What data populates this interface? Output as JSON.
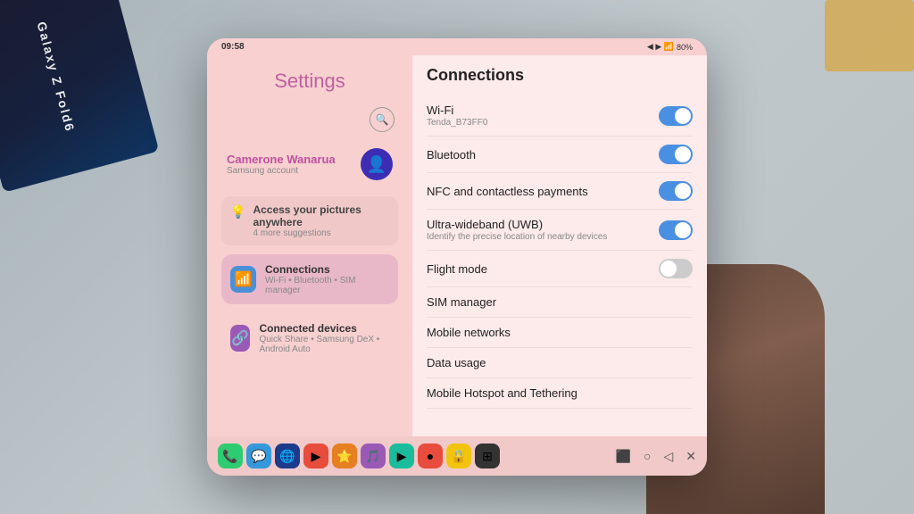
{
  "device": {
    "box_label": "Galaxy Z Fold6"
  },
  "status_bar": {
    "time": "09:58",
    "battery": "80%",
    "signal": "▲▼ 📶"
  },
  "left_panel": {
    "title": "Settings",
    "profile": {
      "name": "Camerone Wanarua",
      "subtitle": "Samsung account"
    },
    "suggestion": {
      "main": "Access your pictures anywhere",
      "sub": "4 more suggestions"
    },
    "menu_items": [
      {
        "id": "connections",
        "label": "Connections",
        "sub": "Wi-Fi • Bluetooth • SIM manager",
        "icon": "📶",
        "active": true
      },
      {
        "id": "connected-devices",
        "label": "Connected devices",
        "sub": "Quick Share • Samsung DeX • Android Auto",
        "icon": "🔗",
        "active": false
      }
    ]
  },
  "right_panel": {
    "title": "Connections",
    "settings": [
      {
        "id": "wifi",
        "label": "Wi-Fi",
        "sub": "Tenda_B73FF0",
        "toggle": "on"
      },
      {
        "id": "bluetooth",
        "label": "Bluetooth",
        "sub": "",
        "toggle": "on"
      },
      {
        "id": "nfc",
        "label": "NFC and contactless payments",
        "sub": "",
        "toggle": "on"
      },
      {
        "id": "uwb",
        "label": "Ultra-wideband (UWB)",
        "sub": "Identify the precise location of nearby devices",
        "toggle": "on"
      },
      {
        "id": "flight",
        "label": "Flight mode",
        "sub": "",
        "toggle": "off"
      },
      {
        "id": "sim",
        "label": "SIM manager",
        "sub": "",
        "toggle": null
      },
      {
        "id": "mobile-networks",
        "label": "Mobile networks",
        "sub": "",
        "toggle": null
      },
      {
        "id": "data-usage",
        "label": "Data usage",
        "sub": "",
        "toggle": null
      },
      {
        "id": "hotspot",
        "label": "Mobile Hotspot and Tethering",
        "sub": "",
        "toggle": null
      }
    ]
  },
  "navbar": {
    "apps": [
      {
        "color": "green",
        "icon": "📞"
      },
      {
        "color": "blue",
        "icon": "💬"
      },
      {
        "color": "dark-blue",
        "icon": "🌐"
      },
      {
        "color": "red",
        "icon": "▶"
      },
      {
        "color": "orange",
        "icon": "⭐"
      },
      {
        "color": "purple",
        "icon": "🎵"
      },
      {
        "color": "teal",
        "icon": "▶"
      },
      {
        "color": "red",
        "icon": "●"
      },
      {
        "color": "yellow",
        "icon": "🔒"
      },
      {
        "color": "dark",
        "icon": "⊞"
      }
    ],
    "controls": [
      "⬛",
      "○",
      "◁"
    ]
  }
}
